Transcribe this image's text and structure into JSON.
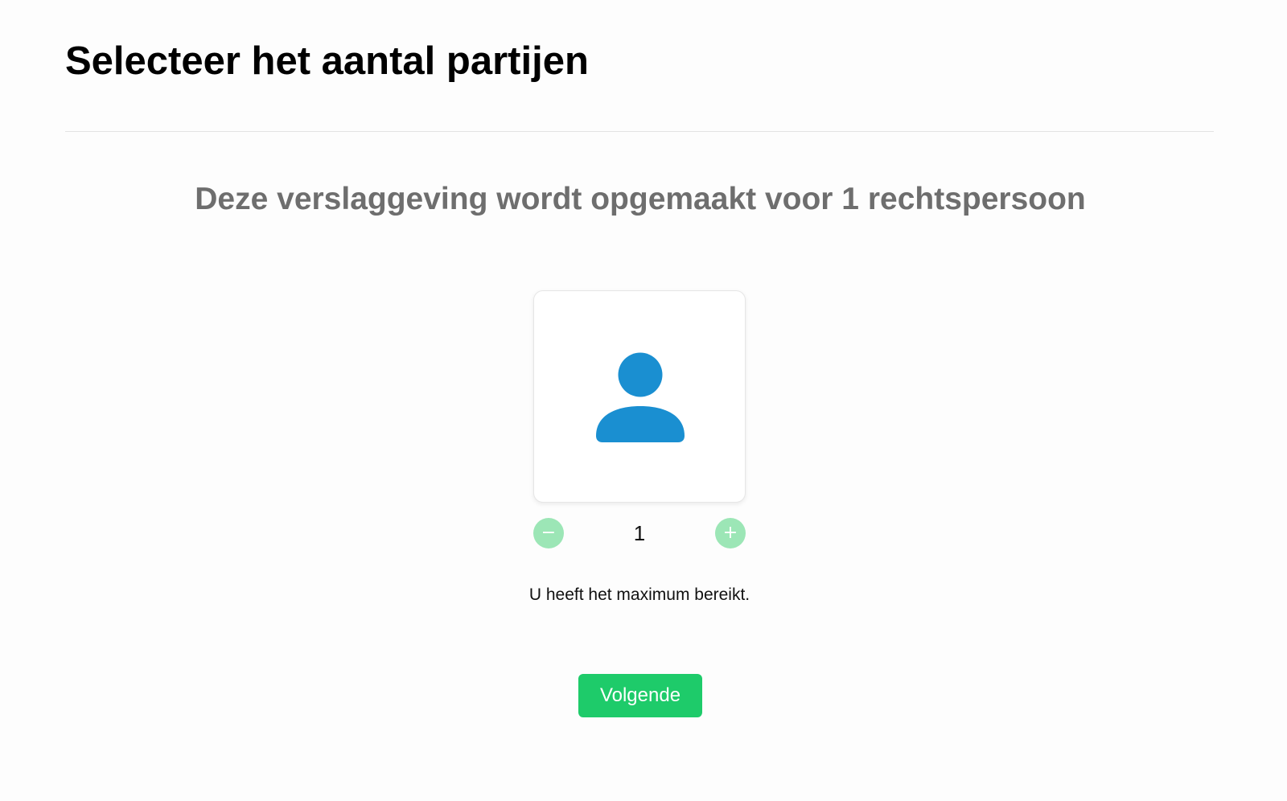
{
  "header": {
    "title": "Selecteer het aantal partijen"
  },
  "main": {
    "subtitle": "Deze verslaggeving wordt opgemaakt voor 1 rechtspersoon",
    "party_card": {
      "icon": "person-icon",
      "icon_color": "#1a8fd1"
    },
    "stepper": {
      "minus_symbol": "−",
      "plus_symbol": "+",
      "value": "1",
      "button_color": "#9ce6b6",
      "minus_icon": "minus-icon",
      "plus_icon": "plus-icon"
    },
    "status_message": "U heeft het maximum bereikt.",
    "next_button": {
      "label": "Volgende",
      "color": "#1ecb6a"
    }
  }
}
